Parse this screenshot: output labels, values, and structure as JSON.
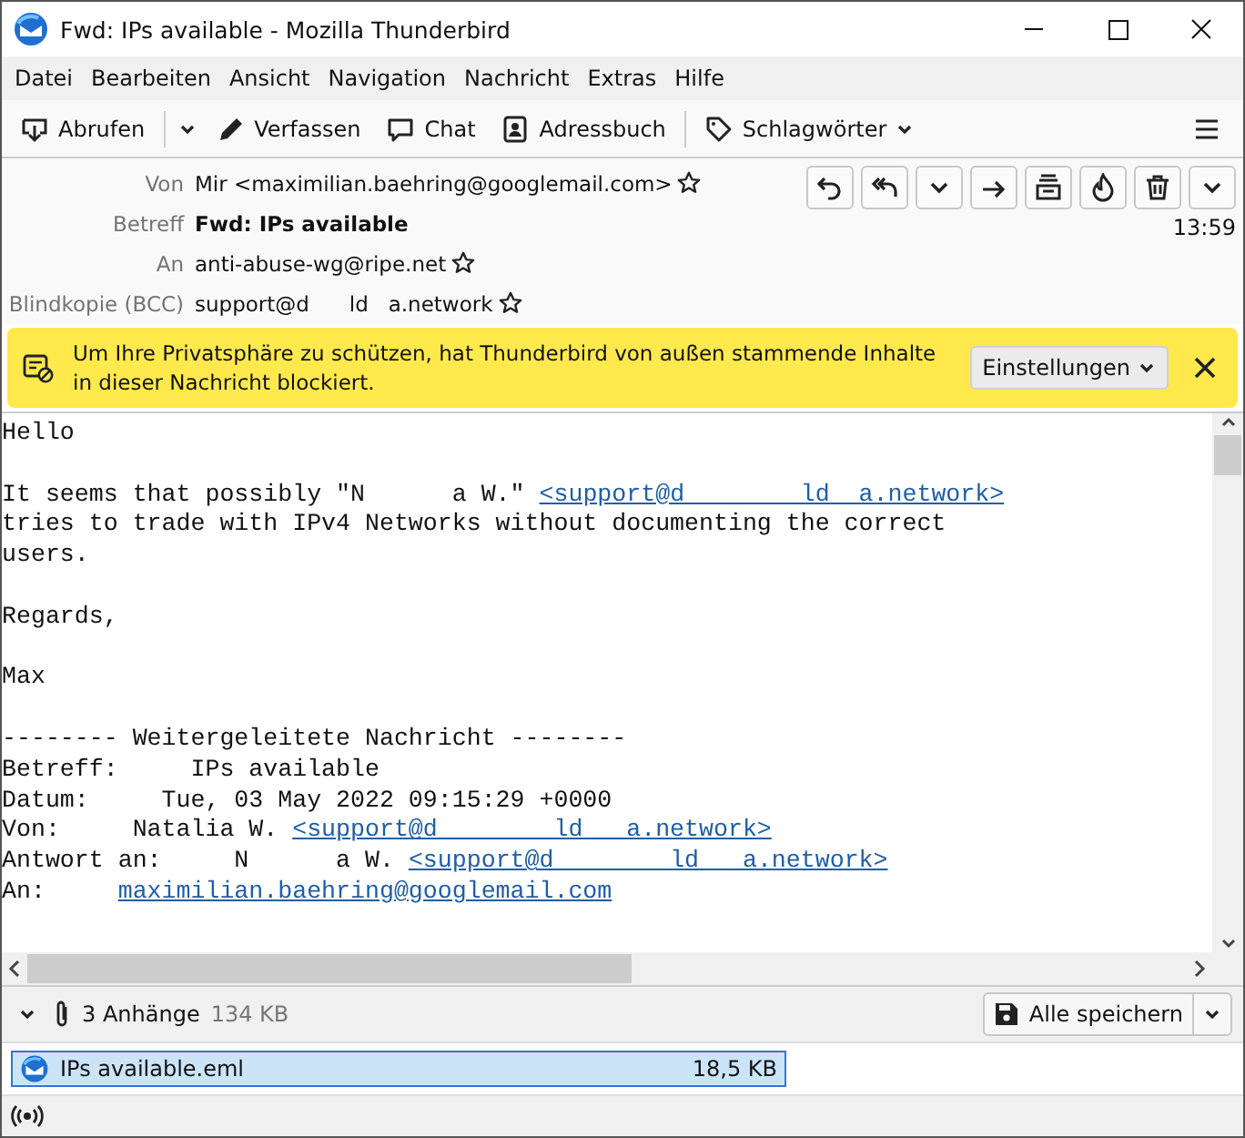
{
  "window": {
    "title": "Fwd: IPs available - Mozilla Thunderbird"
  },
  "menu": [
    "Datei",
    "Bearbeiten",
    "Ansicht",
    "Navigation",
    "Nachricht",
    "Extras",
    "Hilfe"
  ],
  "toolbar": [
    {
      "kind": "get",
      "label": "Abrufen",
      "dropdown": true
    },
    {
      "kind": "compose",
      "label": "Verfassen",
      "dropdown": false
    },
    {
      "kind": "chat",
      "label": "Chat",
      "dropdown": false
    },
    {
      "kind": "addressbook",
      "label": "Adressbuch",
      "dropdown": false
    },
    {
      "kind": "tag",
      "label": "Schlagwörter",
      "dropdown": true
    }
  ],
  "header": {
    "fields": [
      {
        "label": "Von",
        "value": "Mir <maximilian.baehring@googlemail.com>",
        "star": true,
        "bold": false
      },
      {
        "label": "Betreff",
        "value": "Fwd: IPs available",
        "star": false,
        "bold": true
      },
      {
        "label": "An",
        "value": "anti-abuse-wg@ripe.net",
        "star": true,
        "bold": false
      },
      {
        "label": "Blindkopie (BCC)",
        "value": "support@d      ld   a.network",
        "star": true,
        "bold": false
      }
    ],
    "time": "13:59",
    "actions": [
      {
        "kind": "reply"
      },
      {
        "kind": "reply-all"
      },
      {
        "kind": "more"
      },
      {
        "kind": "forward"
      },
      {
        "kind": "archive"
      },
      {
        "kind": "junk"
      },
      {
        "kind": "delete"
      },
      {
        "kind": "menu"
      }
    ]
  },
  "notification": {
    "text": "Um Ihre Privatsphäre zu schützen, hat Thunderbird von außen stammende Inhalte in dieser Nachricht blockiert.",
    "button": "Einstellungen"
  },
  "body": [
    [
      {
        "text": "Hello"
      }
    ],
    [
      {
        "text": "It seems that possibly \"N      a W.\" ",
        "link": "<support@d        ld  a.network>"
      },
      {
        "text": "tries to trade with IPv4 Networks without documenting the correct"
      },
      {
        "text": "users."
      }
    ],
    [
      {
        "text": "Regards,"
      }
    ],
    [
      {
        "text": "Max"
      }
    ],
    [
      {
        "text": "-------- Weitergeleitete Nachricht --------"
      },
      {
        "text": "Betreff:     IPs available"
      },
      {
        "text": "Datum:     Tue, 03 May 2022 09:15:29 +0000"
      },
      {
        "text": "Von:     Natalia W. ",
        "link": "<support@d        ld   a.network>"
      },
      {
        "text": "Antwort an:     N      a W. ",
        "link": "<support@d        ld   a.network>"
      },
      {
        "text": "An:     ",
        "link": "maximilian.baehring@googlemail.com"
      }
    ]
  ],
  "attachments": {
    "count": "3 Anhänge",
    "size": "134 KB",
    "save": "Alle speichern",
    "items": [
      {
        "name": "IPs available.eml",
        "size": "18,5 KB",
        "selected": true
      }
    ]
  }
}
